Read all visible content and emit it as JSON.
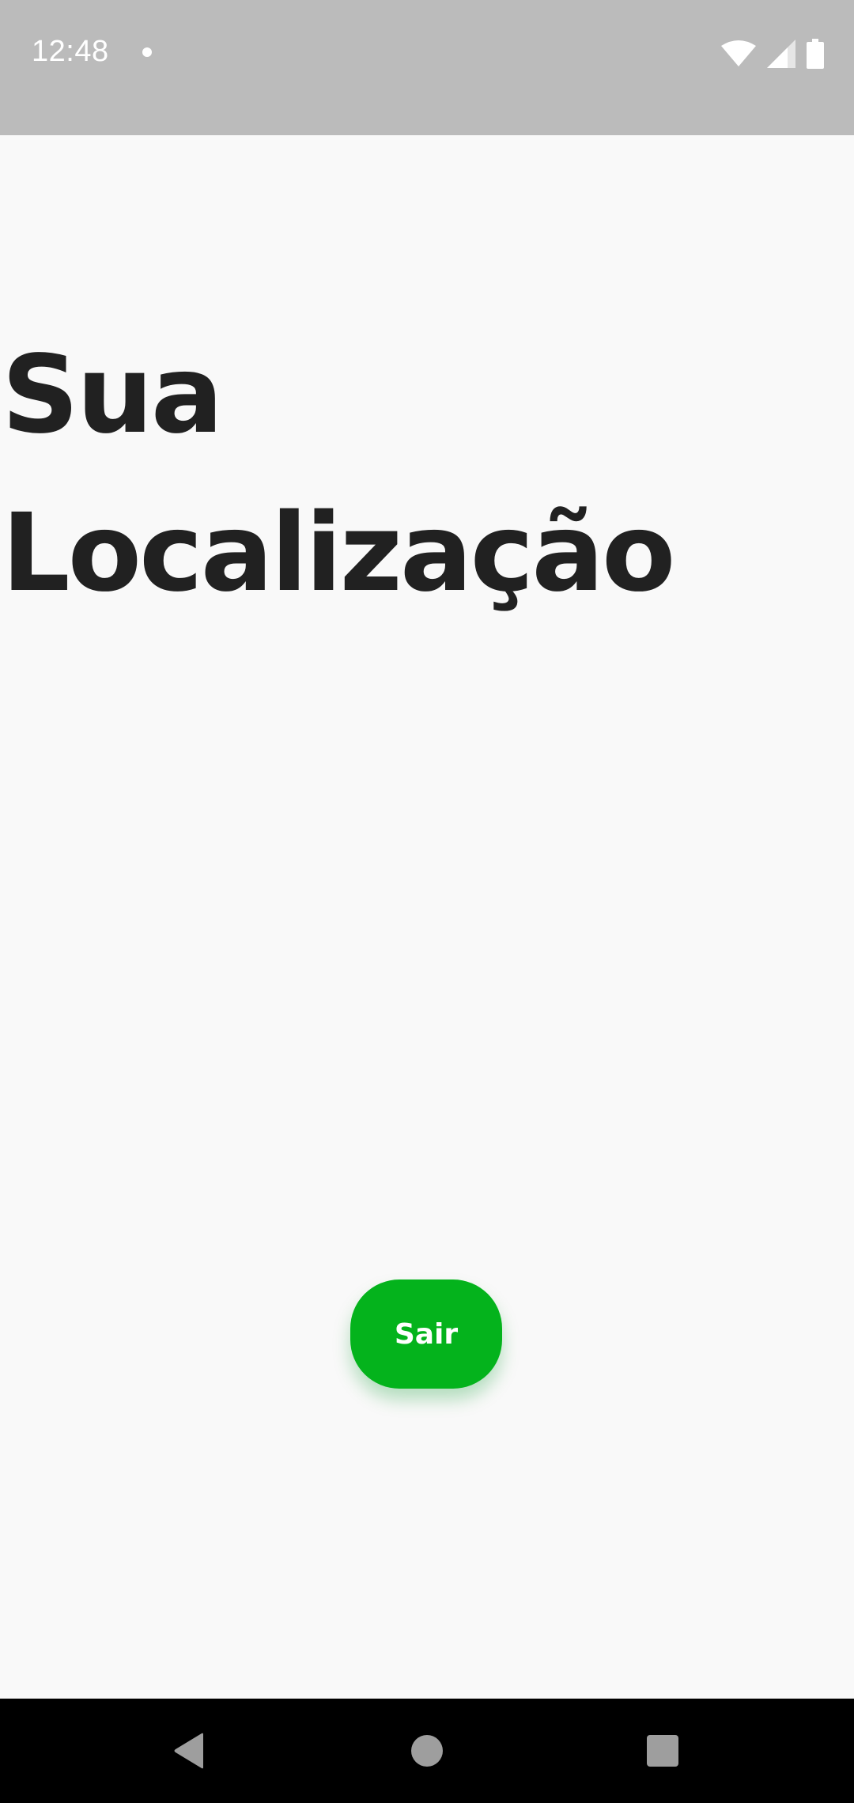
{
  "status_bar": {
    "time": "12:48",
    "icons": [
      "notification-dot-icon",
      "wifi-icon",
      "cell-signal-icon",
      "battery-icon"
    ]
  },
  "page": {
    "title_line1": "Sua",
    "title_line2": "Localização"
  },
  "actions": {
    "exit_label": "Sair"
  },
  "nav_bar": {
    "icons": [
      "back-icon",
      "home-icon",
      "recents-icon"
    ]
  },
  "colors": {
    "status_bar_bg": "#bbbbbb",
    "page_bg": "#f9f9f9",
    "title_text": "#212121",
    "accent_green": "#04b31c",
    "nav_bar_bg": "#000000"
  }
}
